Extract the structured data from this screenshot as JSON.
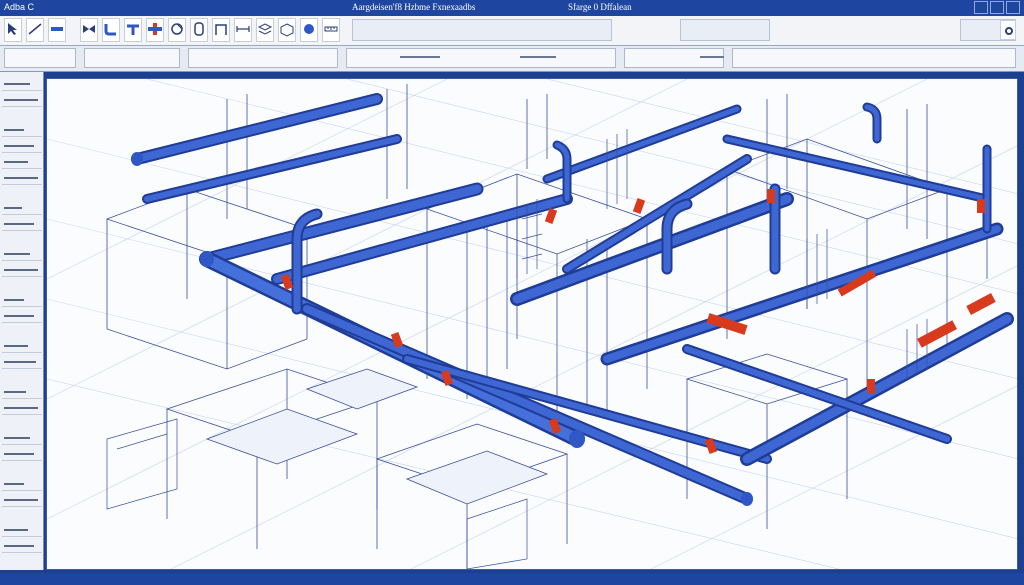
{
  "titlebar": {
    "app_title": "Adba C",
    "document_title": "Aargdeisen'f8 Hzbme Fxnexaadbs",
    "workspace_title": "Sfarge 0 Dffalean"
  },
  "ribbon": {
    "tools": [
      "select-icon",
      "line-icon",
      "pipe-icon",
      "valve-icon",
      "elbow-icon",
      "tee-icon",
      "flange-icon",
      "pump-icon",
      "tank-icon",
      "support-icon",
      "dimension-icon",
      "layer-icon",
      "view-icon",
      "render-icon",
      "measure-icon",
      "settings-icon"
    ]
  },
  "colors": {
    "pipe_blue": "#2f57c6",
    "pipe_dark": "#1f3c96",
    "steel": "#3a4f9c",
    "valve_red": "#d83a1e",
    "background": "#fbfcfe",
    "chrome": "#1e46a0"
  },
  "status": {
    "text": ""
  }
}
